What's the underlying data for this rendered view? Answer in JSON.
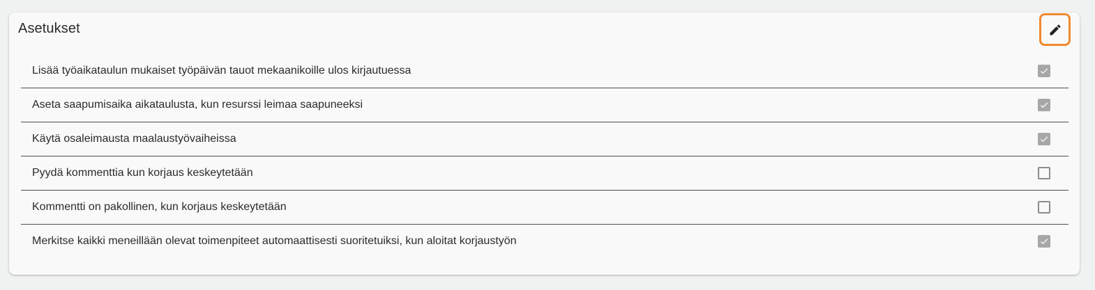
{
  "card": {
    "title": "Asetukset",
    "edit_highlight_color": "#f0892f"
  },
  "settings": [
    {
      "label": "Lisää työaikataulun mukaiset työpäivän tauot mekaanikoille ulos kirjautuessa",
      "checked": true
    },
    {
      "label": "Aseta saapumisaika aikataulusta, kun resurssi leimaa saapuneeksi",
      "checked": true
    },
    {
      "label": "Käytä osaleimausta maalaustyövaiheissa",
      "checked": true
    },
    {
      "label": "Pyydä kommenttia kun korjaus keskeytetään",
      "checked": false
    },
    {
      "label": "Kommentti on pakollinen, kun korjaus keskeytetään",
      "checked": false
    },
    {
      "label": "Merkitse kaikki meneillään olevat toimenpiteet automaattisesti suoritetuiksi, kun aloitat korjaustyön",
      "checked": true
    }
  ],
  "icons": {
    "edit": "pencil-icon",
    "checked": "checkmark-icon"
  }
}
